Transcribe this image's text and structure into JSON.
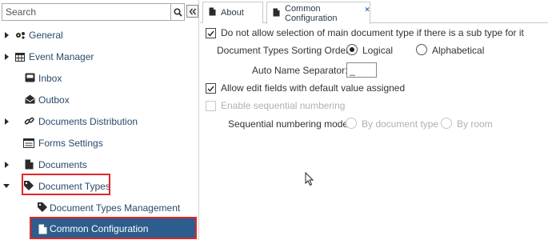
{
  "sidebar": {
    "search_placeholder": "Search",
    "items": [
      {
        "label": "General",
        "icon": "gears-icon",
        "expandable": true
      },
      {
        "label": "Event Manager",
        "icon": "calendar-icon",
        "expandable": true
      },
      {
        "label": "Inbox",
        "icon": "inbox-icon",
        "expandable": false
      },
      {
        "label": "Outbox",
        "icon": "outbox-icon",
        "expandable": false
      },
      {
        "label": "Documents Distribution",
        "icon": "link-icon",
        "expandable": true
      },
      {
        "label": "Forms Settings",
        "icon": "form-icon",
        "expandable": false
      },
      {
        "label": "Documents",
        "icon": "document-icon",
        "expandable": true
      },
      {
        "label": "Document Types",
        "icon": "tag-icon",
        "expandable": true,
        "expanded": true
      },
      {
        "label": "Document Types Management",
        "icon": "tag-icon",
        "child": true
      },
      {
        "label": "Common Configuration",
        "icon": "document-icon",
        "child": true,
        "selected": true
      }
    ]
  },
  "tabs": [
    {
      "label": "About",
      "active": false
    },
    {
      "label": "Common Configuration",
      "active": true,
      "close": "×"
    }
  ],
  "main": {
    "opt_no_main_type": {
      "label": "Do not allow selection of main document type if there is a sub type for it",
      "checked": true
    },
    "sorting": {
      "label": "Document Types Sorting Order:",
      "options": [
        "Logical",
        "Alphabetical"
      ],
      "selected": "Logical"
    },
    "auto_name_sep": {
      "label": "Auto Name Separator:",
      "value": "_"
    },
    "opt_allow_edit": {
      "label": "Allow edit fields with default value assigned",
      "checked": true
    },
    "opt_seq_numbering": {
      "label": "Enable sequential numbering",
      "checked": false,
      "disabled": true
    },
    "seq_mode": {
      "label": "Sequential numbering mode:",
      "options": [
        "By document type",
        "By room"
      ],
      "disabled": true
    }
  },
  "colors": {
    "selected_bg": "#2c5d8c",
    "highlight_border": "#e0262a",
    "link_text": "#2a4a6a"
  }
}
